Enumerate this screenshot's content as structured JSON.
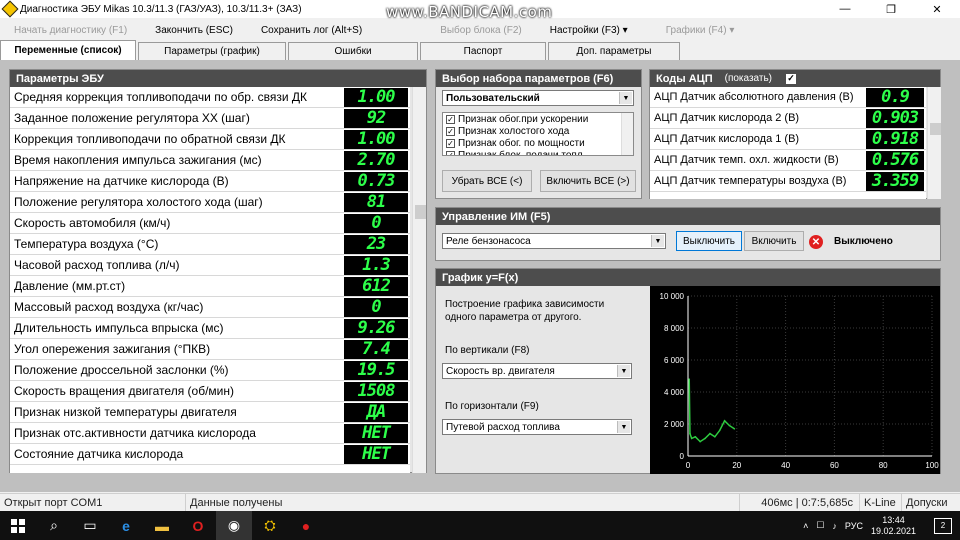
{
  "window": {
    "title": "Диагностика ЭБУ Mikas 10.3/11.3 (ГАЗ/УАЗ), 10.3/11.3+ (ЗАЗ)",
    "watermark": "www.BANDICAM.com",
    "controls": [
      "—",
      "❐",
      "✕"
    ]
  },
  "menu": [
    {
      "label": "Начать диагностику (F1)",
      "disabled": true
    },
    {
      "label": "Закончить (ESC)",
      "disabled": false
    },
    {
      "label": "Сохранить лог (Alt+S)",
      "disabled": false
    },
    {
      "label": "Выбор блока (F2)",
      "disabled": true
    },
    {
      "label": "Настройки (F3) ▾",
      "disabled": false
    },
    {
      "label": "Графики (F4) ▾",
      "disabled": true
    }
  ],
  "tabs": [
    "Переменные (список)",
    "Параметры (график)",
    "Ошибки",
    "Паспорт",
    "Доп. параметры"
  ],
  "ecu_params": {
    "title": "Параметры ЭБУ",
    "rows": [
      {
        "name": "Средняя коррекция топливоподачи по обр. связи ДК",
        "value": "1.00"
      },
      {
        "name": "Заданное положение регулятора ХХ (шаг)",
        "value": "92"
      },
      {
        "name": "Коррекция топливоподачи по обратной связи ДК",
        "value": "1.00"
      },
      {
        "name": "Время накопления импульса зажигания (мс)",
        "value": "2.70"
      },
      {
        "name": "Напряжение на датчике кислорода (В)",
        "value": "0.73"
      },
      {
        "name": "Положение регулятора холостого хода (шаг)",
        "value": "81"
      },
      {
        "name": "Скорость автомобиля (км/ч)",
        "value": "0"
      },
      {
        "name": "Температура воздуха (°С)",
        "value": "23"
      },
      {
        "name": "Часовой расход топлива (л/ч)",
        "value": "1.3"
      },
      {
        "name": "Давление (мм.рт.ст)",
        "value": "612"
      },
      {
        "name": "Массовый расход воздуха (кг/час)",
        "value": "0"
      },
      {
        "name": "Длительность импульса впрыска (мс)",
        "value": "9.26"
      },
      {
        "name": "Угол опережения зажигания (°ПКВ)",
        "value": "7.4"
      },
      {
        "name": "Положение дроссельной заслонки (%)",
        "value": "19.5"
      },
      {
        "name": "Скорость вращения двигателя (об/мин)",
        "value": "1508"
      },
      {
        "name": "Признак низкой температуры двигателя",
        "value": "ДА"
      },
      {
        "name": "Признак отс.активности датчика кислорода",
        "value": "НЕТ"
      },
      {
        "name": "Состояние датчика кислорода",
        "value": "НЕТ"
      }
    ]
  },
  "param_set": {
    "title": "Выбор набора параметров (F6)",
    "selected": "Пользовательский",
    "items": [
      {
        "label": "Признак обог.при ускорении",
        "checked": true
      },
      {
        "label": "Признак холостого хода",
        "checked": true
      },
      {
        "label": "Признак обог. по мощности",
        "checked": true
      },
      {
        "label": "Признак блок. подачи топл.",
        "checked": true
      }
    ],
    "btn_remove_all": "Убрать ВСЕ (<)",
    "btn_add_all": "Включить ВСЕ (>)"
  },
  "adc": {
    "title": "Коды АЦП",
    "show_label": "(показать)",
    "show_checked": "✓",
    "rows": [
      {
        "name": "АЦП Датчик абсолютного давления (В)",
        "value": "0.9"
      },
      {
        "name": "АЦП Датчик кислорода 2 (В)",
        "value": "0.903"
      },
      {
        "name": "АЦП Датчик кислорода 1 (В)",
        "value": "0.918"
      },
      {
        "name": "АЦП Датчик темп. охл. жидкости (В)",
        "value": "0.576"
      },
      {
        "name": "АЦП Датчик температуры воздуха (В)",
        "value": "3.359"
      }
    ]
  },
  "actuator": {
    "title": "Управление ИМ (F5)",
    "selected": "Реле бензонасоса",
    "btn_off": "Выключить",
    "btn_on": "Включить",
    "status": "Выключено"
  },
  "graph": {
    "title": "График y=F(x)",
    "description": "Построение графика зависимости одного параметра от другого.",
    "vertical_label": "По вертикали (F8)",
    "vertical_value": "Скорость вр. двигателя",
    "horizontal_label": "По горизонтали (F9)",
    "horizontal_value": "Путевой расход топлива"
  },
  "chart_data": {
    "type": "line",
    "title": "",
    "xlabel": "",
    "ylabel": "",
    "xlim": [
      0,
      100
    ],
    "ylim": [
      0,
      10000
    ],
    "xticks": [
      "0",
      "20",
      "40",
      "60",
      "80",
      "100"
    ],
    "yticks": [
      "0",
      "2 000",
      "4 000",
      "6 000",
      "8 000",
      "10 000"
    ],
    "grid": true,
    "series": [
      {
        "color": "#2ecc40",
        "x": [
          0.5,
          0.8,
          1.5,
          3,
          5,
          7,
          9,
          11,
          13,
          15,
          17,
          19
        ],
        "y": [
          4800,
          1400,
          1100,
          1200,
          900,
          1100,
          1400,
          1200,
          1600,
          2200,
          1900,
          1700
        ]
      }
    ]
  },
  "status": {
    "port": "Открыт порт COM1",
    "data": "Данные получены",
    "timing": "406мс | 0:7:5,685с",
    "line": "K-Line",
    "allowed": "Допуски"
  },
  "taskbar": {
    "lang": "РУС",
    "time": "13:44",
    "date": "19.02.2021",
    "notifications": "2"
  }
}
